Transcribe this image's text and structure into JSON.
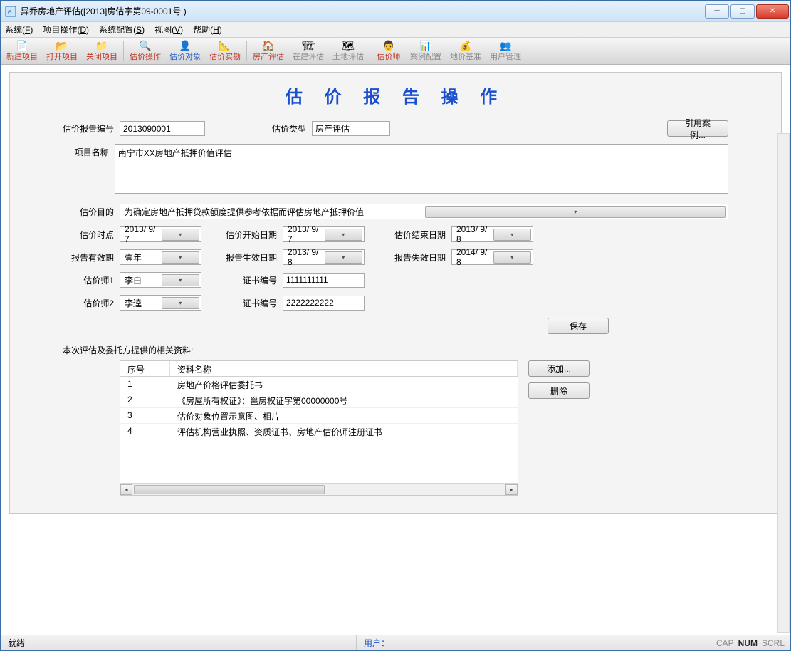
{
  "window": {
    "title": "异乔房地产评估([2013]房估字第09-0001号 )"
  },
  "menu": {
    "system": "系统",
    "system_u": "F",
    "project": "项目操作",
    "project_u": "D",
    "config": "系统配置",
    "config_u": "S",
    "view": "视图",
    "view_u": "V",
    "help": "帮助",
    "help_u": "H"
  },
  "toolbar": [
    {
      "name": "new-project",
      "label": "新建项目",
      "cls": "lbl-red",
      "icon": "📄"
    },
    {
      "name": "open-project",
      "label": "打开项目",
      "cls": "lbl-red",
      "icon": "📂"
    },
    {
      "name": "close-project",
      "label": "关闭项目",
      "cls": "lbl-red",
      "icon": "📁"
    },
    {
      "name": "sep"
    },
    {
      "name": "valuation-op",
      "label": "估价操作",
      "cls": "lbl-red",
      "icon": "🔍"
    },
    {
      "name": "valuation-obj",
      "label": "估价对象",
      "cls": "lbl-blue",
      "icon": "👤"
    },
    {
      "name": "valuation-survey",
      "label": "估价实勘",
      "cls": "lbl-red",
      "icon": "📐"
    },
    {
      "name": "sep"
    },
    {
      "name": "property-eval",
      "label": "房产评估",
      "cls": "lbl-red",
      "icon": "🏠"
    },
    {
      "name": "construction-eval",
      "label": "在建评估",
      "cls": "lbl-gray",
      "icon": "🏗"
    },
    {
      "name": "land-eval",
      "label": "土地评估",
      "cls": "lbl-gray",
      "icon": "🗺"
    },
    {
      "name": "sep"
    },
    {
      "name": "appraiser",
      "label": "估价师",
      "cls": "lbl-red",
      "icon": "👨"
    },
    {
      "name": "case-config",
      "label": "案例配置",
      "cls": "lbl-gray",
      "icon": "📊"
    },
    {
      "name": "land-base",
      "label": "地价基准",
      "cls": "lbl-gray",
      "icon": "💰"
    },
    {
      "name": "user-mgmt",
      "label": "用户管理",
      "cls": "lbl-gray",
      "icon": "👥"
    }
  ],
  "page_title": "估 价 报 告 操 作",
  "labels": {
    "report_no": "估价报告编号",
    "val_type": "估价类型",
    "ref_case": "引用案例...",
    "project_name": "项目名称",
    "purpose": "估价目的",
    "val_time": "估价时点",
    "start_date": "估价开始日期",
    "end_date": "估价结束日期",
    "validity": "报告有效期",
    "effective_date": "报告生效日期",
    "expire_date": "报告失效日期",
    "appraiser1": "估价师1",
    "cert_no": "证书编号",
    "appraiser2": "估价师2",
    "save": "保存",
    "materials_title": "本次评估及委托方提供的相关资料:",
    "col_seq": "序号",
    "col_name": "资料名称",
    "add": "添加...",
    "delete": "删除"
  },
  "form": {
    "report_no": "2013090001",
    "val_type": "房产评估",
    "project_name": "南宁市XX房地产抵押价值评估",
    "purpose": "为确定房地产抵押贷款额度提供参考依据而评估房地产抵押价值",
    "val_time": "2013/ 9/ 7",
    "start_date": "2013/ 9/ 7",
    "end_date": "2013/ 9/ 8",
    "validity": "壹年",
    "effective_date": "2013/ 9/ 8",
    "expire_date": "2014/ 9/ 8",
    "appraiser1": "李白",
    "cert1": "1111111111",
    "appraiser2": "李逵",
    "cert2": "2222222222"
  },
  "materials": [
    {
      "seq": "1",
      "name": "房地产价格评估委托书"
    },
    {
      "seq": "2",
      "name": "《房屋所有权证》：邕房权证字第00000000号"
    },
    {
      "seq": "3",
      "name": "估价对象位置示意图、相片"
    },
    {
      "seq": "4",
      "name": "评估机构营业执照、资质证书、房地产估价师注册证书"
    }
  ],
  "status": {
    "ready": "就绪",
    "user": "用户：",
    "cap": "CAP",
    "num": "NUM",
    "scrl": "SCRL"
  }
}
